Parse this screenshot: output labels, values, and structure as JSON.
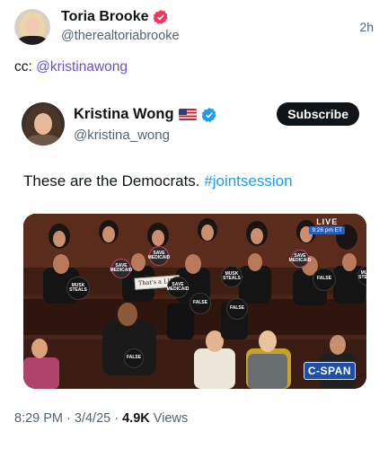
{
  "post": {
    "author_name": "Toria Brooke",
    "author_handle": "@therealtoriabrooke",
    "timestamp": "2h",
    "text_prefix": "cc: ",
    "mention": "@kristinawong",
    "verified_icon": "verified-badge-icon",
    "verified_color": "#f4345f"
  },
  "quoted": {
    "author_name": "Kristina Wong",
    "flag_icon": "us-flag-icon",
    "author_handle": "@kristina_wong",
    "subscribe_label": "Subscribe",
    "verified_color": "#1d9bf0",
    "text": "These are the Democrats. ",
    "hashtag": "#jointsession"
  },
  "media": {
    "live_label": "LIVE",
    "live_time": "9:26 pm ET",
    "network_logo": "C-SPAN",
    "signs": {
      "musk_steals_1": "MUSK STEALS",
      "save_medicaid_1": "SAVE MEDICAID",
      "save_medicaid_2": "SAVE MEDICAID",
      "paper_sign": "That's a LIE!",
      "save_medicaid_3": "SAVE MEDICAID",
      "false_1": "FALSE",
      "musk_steals_2": "MUSK STEALS",
      "false_2": "FALSE",
      "save_medicaid_4": "SAVE MEDICAID",
      "false_3": "FALSE",
      "musk_steals_3": "MUSK STEALS",
      "false_4": "FALSE"
    }
  },
  "meta": {
    "time": "8:29 PM",
    "separator": " · ",
    "date": "3/4/25",
    "views_count": "4.9K",
    "views_label": " Views"
  }
}
